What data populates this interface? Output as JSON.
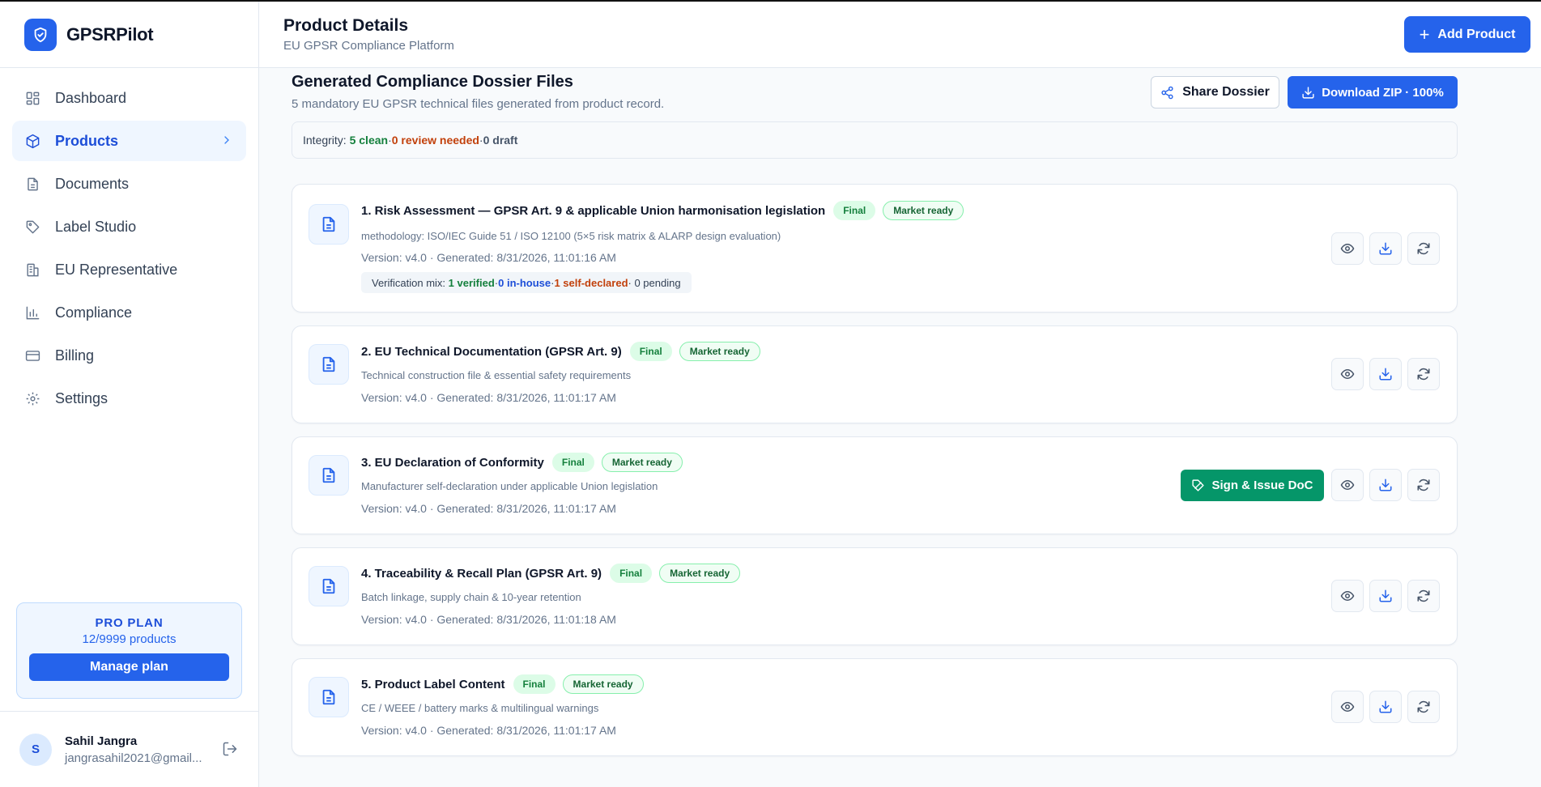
{
  "app": {
    "name": "GPSRPilot"
  },
  "sidebar": {
    "items": [
      {
        "label": "Dashboard"
      },
      {
        "label": "Products"
      },
      {
        "label": "Documents"
      },
      {
        "label": "Label Studio"
      },
      {
        "label": "EU Representative"
      },
      {
        "label": "Compliance"
      },
      {
        "label": "Billing"
      },
      {
        "label": "Settings"
      }
    ],
    "active": "Products",
    "plan": {
      "title": "PRO PLAN",
      "count": "12/9999 products",
      "button": "Manage plan"
    },
    "user": {
      "initial": "S",
      "name": "Sahil Jangra",
      "email": "jangrasahil2021@gmail..."
    }
  },
  "header": {
    "title": "Product Details",
    "subtitle": "EU GPSR Compliance Platform",
    "add_button": "Add Product"
  },
  "dossier": {
    "title": "Generated Compliance Dossier Files",
    "subtitle": "5 mandatory EU GPSR technical files generated from product record.",
    "share_button": "Share Dossier",
    "download_button": "Download ZIP · 100%",
    "integrity": {
      "label": "Integrity:",
      "clean": "5 clean",
      "sep1": " · ",
      "review": "0 review needed",
      "sep2": " · ",
      "draft": "0 draft"
    }
  },
  "files": [
    {
      "title": "1. Risk Assessment — GPSR Art. 9 & applicable Union harmonisation legislation",
      "badge_final": "Final",
      "badge_market": "Market ready",
      "desc": "methodology: ISO/IEC Guide 51 / ISO 12100 (5×5 risk matrix & ALARP design evaluation)",
      "version": "Version: v4.0 · Generated: 8/31/2026, 11:01:16 AM",
      "verification": {
        "label": "Verification mix:",
        "verified": "1 verified",
        "sep1": " · ",
        "inhouse": "0 in-house",
        "sep2": " · ",
        "selfdeclared": "1 self-declared",
        "pending": " · 0 pending"
      }
    },
    {
      "title": "2. EU Technical Documentation (GPSR Art. 9)",
      "badge_final": "Final",
      "badge_market": "Market ready",
      "desc": "Technical construction file & essential safety requirements",
      "version": "Version: v4.0 · Generated: 8/31/2026, 11:01:17 AM"
    },
    {
      "title": "3. EU Declaration of Conformity",
      "badge_final": "Final",
      "badge_market": "Market ready",
      "desc": "Manufacturer self-declaration under applicable Union legislation",
      "version": "Version: v4.0 · Generated: 8/31/2026, 11:01:17 AM",
      "sign_button": "Sign & Issue DoC"
    },
    {
      "title": "4. Traceability & Recall Plan (GPSR Art. 9)",
      "badge_final": "Final",
      "badge_market": "Market ready",
      "desc": "Batch linkage, supply chain & 10-year retention",
      "version": "Version: v4.0 · Generated: 8/31/2026, 11:01:18 AM"
    },
    {
      "title": "5. Product Label Content",
      "badge_final": "Final",
      "badge_market": "Market ready",
      "desc": "CE / WEEE / battery marks & multilingual warnings",
      "version": "Version: v4.0 · Generated: 8/31/2026, 11:01:17 AM"
    }
  ],
  "icons": [
    "shield-check-icon",
    "grid-icon",
    "box-icon",
    "document-icon",
    "tag-icon",
    "building-icon",
    "bar-chart-icon",
    "credit-card-icon",
    "gear-icon",
    "chevron-right-icon",
    "logout-icon",
    "plus-icon",
    "share-icon",
    "download-icon",
    "file-text-icon",
    "eye-icon",
    "refresh-icon",
    "signature-icon"
  ],
  "colors": {
    "primary": "#2563eb",
    "success": "#059669",
    "clean": "#15803d",
    "warning": "#c2410c"
  }
}
